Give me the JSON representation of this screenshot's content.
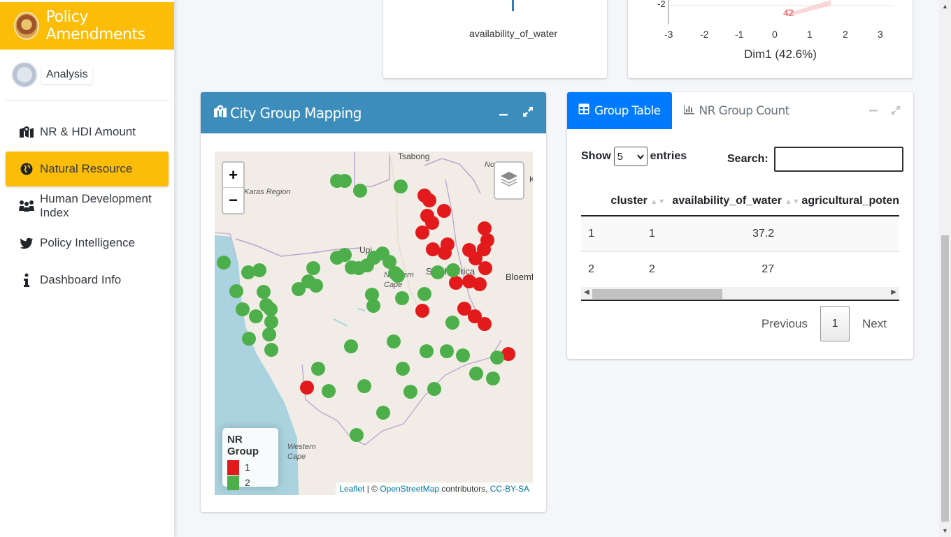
{
  "brand": {
    "title": "Policy Amendments"
  },
  "user": {
    "name": "Analysis"
  },
  "sidebar": {
    "items": [
      {
        "label": "NR & HDI Amount",
        "icon": "map-marker-icon",
        "active": false
      },
      {
        "label": "Natural Resource",
        "icon": "globe-icon",
        "active": true
      },
      {
        "label": "Human Development Index",
        "icon": "people-icon",
        "active": false
      },
      {
        "label": "Policy Intelligence",
        "icon": "twitter-icon",
        "active": false
      },
      {
        "label": "Dashboard Info",
        "icon": "info-icon",
        "active": false
      }
    ]
  },
  "top_cards": {
    "left_axis_label": "availability_of_water",
    "right_y_tick": "-2",
    "right_x_ticks": [
      "-3",
      "-2",
      "-1",
      "0",
      "1",
      "2",
      "3"
    ],
    "right_xlabel": "Dim1 (42.6%)",
    "right_point_label": "42"
  },
  "map_card": {
    "title": "City Group Mapping",
    "zoom_in": "+",
    "zoom_out": "−",
    "place_labels": {
      "tsabong": "Tsabong",
      "karas": "Karas Region",
      "upington": "Upi",
      "northern_cape": "Northern Cape",
      "south_africa": "South Africa",
      "bloemfontein": "Bloemf",
      "western_cape": "Western Cape",
      "nor": "No",
      "k": "K"
    },
    "legend": {
      "title": "NR Group",
      "items": [
        {
          "label": "1",
          "color": "#e31a1c"
        },
        {
          "label": "2",
          "color": "#4daf4a"
        }
      ]
    },
    "attribution": {
      "leaflet": "Leaflet",
      "sep": " | © ",
      "osm": "OpenStreetMap",
      "contrib": " contributors, ",
      "license": "CC-BY-SA"
    }
  },
  "table_card": {
    "tabs": [
      {
        "label": "Group Table",
        "active": true
      },
      {
        "label": "NR Group Count",
        "active": false
      }
    ],
    "show_label": "Show",
    "entries_value": "5",
    "entries_label": "entries",
    "search_label": "Search:",
    "columns": [
      "",
      "cluster",
      "availability_of_water",
      "agricultural_poten"
    ],
    "rows": [
      [
        "1",
        "1",
        "37.2",
        ""
      ],
      [
        "2",
        "2",
        "27",
        ""
      ]
    ],
    "pagination": {
      "previous": "Previous",
      "current": "1",
      "next": "Next"
    }
  },
  "colors": {
    "brand": "#fbbd08",
    "map_header": "#3c8dbc",
    "tab_active": "#007bff",
    "group1": "#e31a1c",
    "group2": "#4daf4a"
  }
}
